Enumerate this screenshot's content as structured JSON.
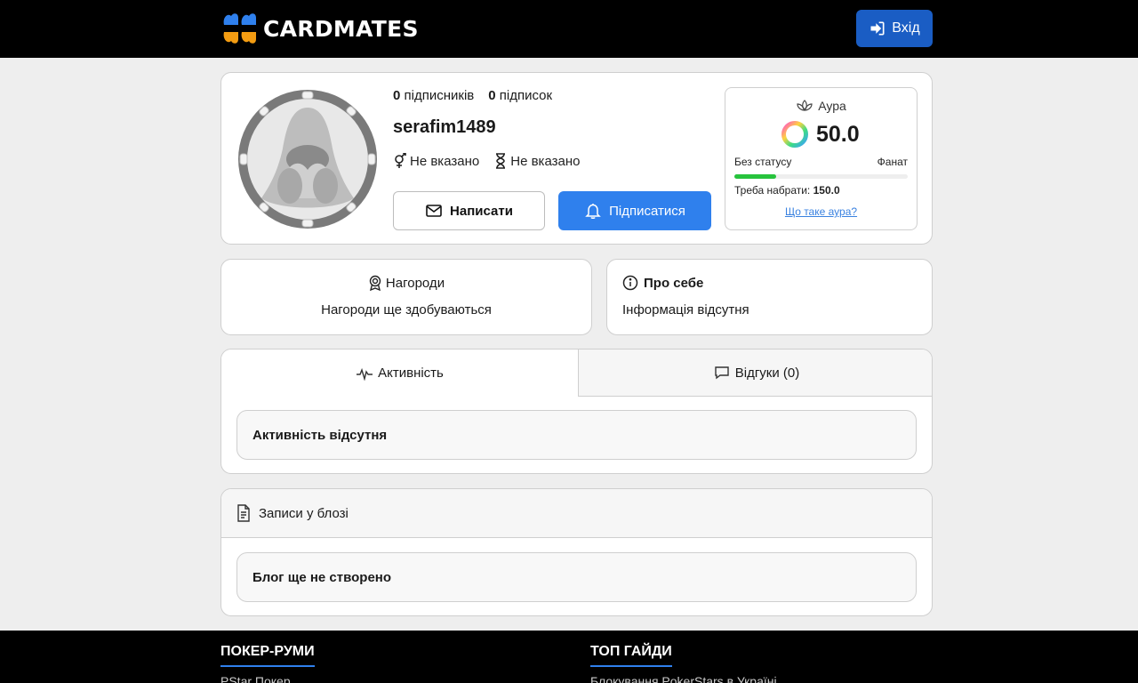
{
  "header": {
    "brand": "CARDMATES",
    "login_label": "Вхід",
    "colors": {
      "brand_blue": "#1a5dc4",
      "brand_orange": "#f39c12"
    }
  },
  "profile": {
    "followers_count": "0",
    "followers_label": "підписників",
    "following_count": "0",
    "following_label": "підписок",
    "username": "serafim1489",
    "gender": "Не вказано",
    "age": "Не вказано",
    "write_label": "Написати",
    "subscribe_label": "Підписатися"
  },
  "aura": {
    "title": "Аура",
    "value": "50.0",
    "level_from": "Без статусу",
    "level_to": "Фанат",
    "progress_percent": 24,
    "need_label": "Треба набрати:",
    "need_value": "150.0",
    "link": "Що таке аура?"
  },
  "awards": {
    "title": "Нагороди",
    "text": "Нагороди ще здобуваються"
  },
  "about": {
    "title": "Про себе",
    "text": "Інформація відсутня"
  },
  "tabs": {
    "activity_label": "Активність",
    "reviews_label": "Відгуки (0)",
    "activity_empty": "Активність відсутня"
  },
  "blog": {
    "title": "Записи у блозі",
    "empty": "Блог ще не створено"
  },
  "footer": {
    "col1_title": "ПОКЕР-РУМИ",
    "col1_link": "PStar Покер",
    "col2_title": "ТОП ГАЙДИ",
    "col2_link": "Блокування PokerStars в Україні"
  }
}
